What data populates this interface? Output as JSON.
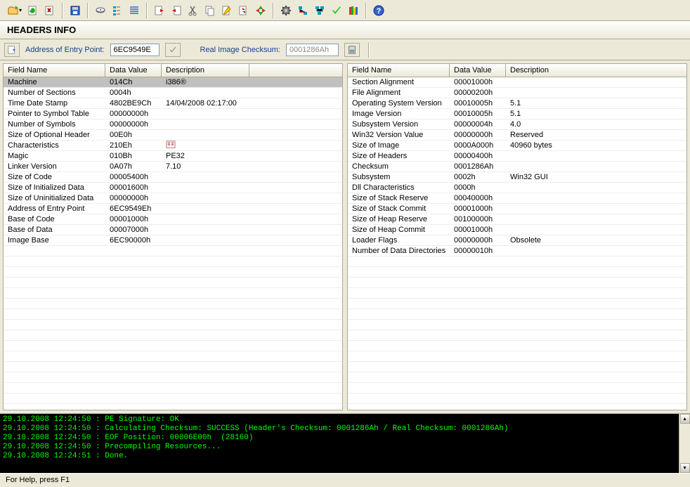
{
  "title": "HEADERS INFO",
  "entry": {
    "label": "Address of Entry Point:",
    "value": "6EC9549E",
    "checksum_label": "Real Image Checksum:",
    "checksum_value": "0001286Ah"
  },
  "left_headers": [
    "Field Name",
    "Data Value",
    "Description"
  ],
  "left_rows": [
    {
      "f": "Machine",
      "v": "014Ch",
      "d": "i386®",
      "sel": true
    },
    {
      "f": "Number of Sections",
      "v": "0004h",
      "d": ""
    },
    {
      "f": "Time Date Stamp",
      "v": "4802BE9Ch",
      "d": "14/04/2008  02:17:00"
    },
    {
      "f": "Pointer to Symbol Table",
      "v": "00000000h",
      "d": ""
    },
    {
      "f": "Number of Symbols",
      "v": "00000000h",
      "d": ""
    },
    {
      "f": "Size of Optional Header",
      "v": "00E0h",
      "d": ""
    },
    {
      "f": "Characteristics",
      "v": "210Eh",
      "d": "",
      "icon": true
    },
    {
      "f": "Magic",
      "v": "010Bh",
      "d": "PE32"
    },
    {
      "f": "Linker Version",
      "v": "0A07h",
      "d": "7.10"
    },
    {
      "f": "Size of Code",
      "v": "00005400h",
      "d": ""
    },
    {
      "f": "Size of Initialized Data",
      "v": "00001600h",
      "d": ""
    },
    {
      "f": "Size of Uninitialized Data",
      "v": "00000000h",
      "d": ""
    },
    {
      "f": "Address of Entry Point",
      "v": "6EC9549Eh",
      "d": ""
    },
    {
      "f": "Base of Code",
      "v": "00001000h",
      "d": ""
    },
    {
      "f": "Base of Data",
      "v": "00007000h",
      "d": ""
    },
    {
      "f": "Image Base",
      "v": "6EC90000h",
      "d": ""
    }
  ],
  "right_headers": [
    "Field Name",
    "Data Value",
    "Description"
  ],
  "right_rows": [
    {
      "f": "Section Alignment",
      "v": "00001000h",
      "d": ""
    },
    {
      "f": "File Alignment",
      "v": "00000200h",
      "d": ""
    },
    {
      "f": "Operating System Version",
      "v": "00010005h",
      "d": "5.1"
    },
    {
      "f": "Image Version",
      "v": "00010005h",
      "d": "5.1"
    },
    {
      "f": "Subsystem Version",
      "v": "00000004h",
      "d": "4.0"
    },
    {
      "f": "Win32 Version Value",
      "v": "00000000h",
      "d": "Reserved"
    },
    {
      "f": "Size of Image",
      "v": "0000A000h",
      "d": "40960 bytes"
    },
    {
      "f": "Size of Headers",
      "v": "00000400h",
      "d": ""
    },
    {
      "f": "Checksum",
      "v": "0001286Ah",
      "d": ""
    },
    {
      "f": "Subsystem",
      "v": "0002h",
      "d": "Win32 GUI"
    },
    {
      "f": "Dll Characteristics",
      "v": "0000h",
      "d": ""
    },
    {
      "f": "Size of Stack Reserve",
      "v": "00040000h",
      "d": ""
    },
    {
      "f": "Size of Stack Commit",
      "v": "00001000h",
      "d": ""
    },
    {
      "f": "Size of Heap Reserve",
      "v": "00100000h",
      "d": ""
    },
    {
      "f": "Size of Heap Commit",
      "v": "00001000h",
      "d": ""
    },
    {
      "f": "Loader Flags",
      "v": "00000000h",
      "d": "Obsolete"
    },
    {
      "f": "Number of Data Directories",
      "v": "00000010h",
      "d": ""
    }
  ],
  "console_lines": [
    "29.10.2008 12:24:50 : PE Signature: OK",
    "29.10.2008 12:24:50 : Calculating Checksum: SUCCESS (Header's Checksum: 0001286Ah / Real Checksum: 0001286Ah)",
    "29.10.2008 12:24:50 : EOF Position: 00006E00h  (28160)",
    "29.10.2008 12:24:50 : Precompiling Resources...",
    "29.10.2008 12:24:51 : Done."
  ],
  "status": "For Help, press F1",
  "empty_rows": 15
}
